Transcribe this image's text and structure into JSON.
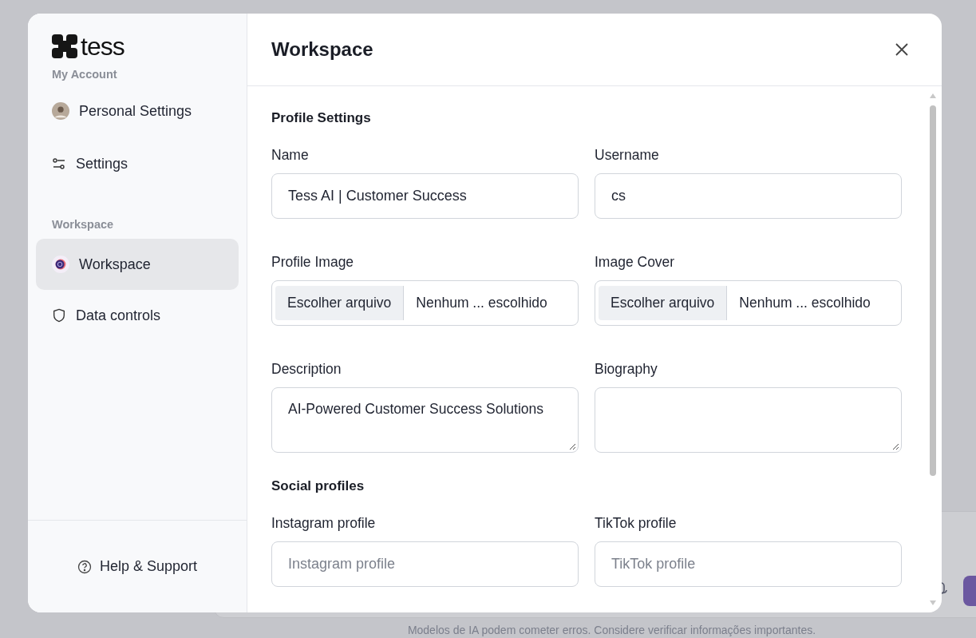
{
  "sidebar": {
    "logo_text": "tess",
    "sections": [
      {
        "title": "My Account",
        "items": [
          {
            "label": "Personal Settings",
            "selected": false
          },
          {
            "label": "Settings",
            "selected": false
          }
        ]
      },
      {
        "title": "Workspace",
        "items": [
          {
            "label": "Workspace",
            "selected": true
          },
          {
            "label": "Data controls",
            "selected": false
          }
        ]
      }
    ],
    "help": "Help & Support"
  },
  "dialog": {
    "title": "Workspace"
  },
  "form_sections": [
    {
      "title": "Profile Settings",
      "fields": [
        {
          "kind": "text",
          "label": "Name",
          "value": "Tess AI | Customer Success"
        },
        {
          "kind": "text",
          "label": "Username",
          "value": "cs"
        },
        {
          "kind": "file",
          "label": "Profile Image",
          "button": "Escolher arquivo",
          "value": "Nenhum ... escolhido"
        },
        {
          "kind": "file",
          "label": "Image Cover",
          "button": "Escolher arquivo",
          "value": "Nenhum ... escolhido"
        },
        {
          "kind": "textarea",
          "label": "Description",
          "value": "AI-Powered Customer Success Solutions"
        },
        {
          "kind": "textarea",
          "label": "Biography"
        }
      ]
    },
    {
      "title": "Social profiles",
      "fields": [
        {
          "kind": "text",
          "label": "Instagram profile",
          "placeholder": "Instagram profile"
        },
        {
          "kind": "text",
          "label": "TikTok profile",
          "placeholder": "TikTok profile"
        }
      ]
    }
  ],
  "footer_note": "Modelos de IA podem cometer erros. Considere verificar informações importantes."
}
